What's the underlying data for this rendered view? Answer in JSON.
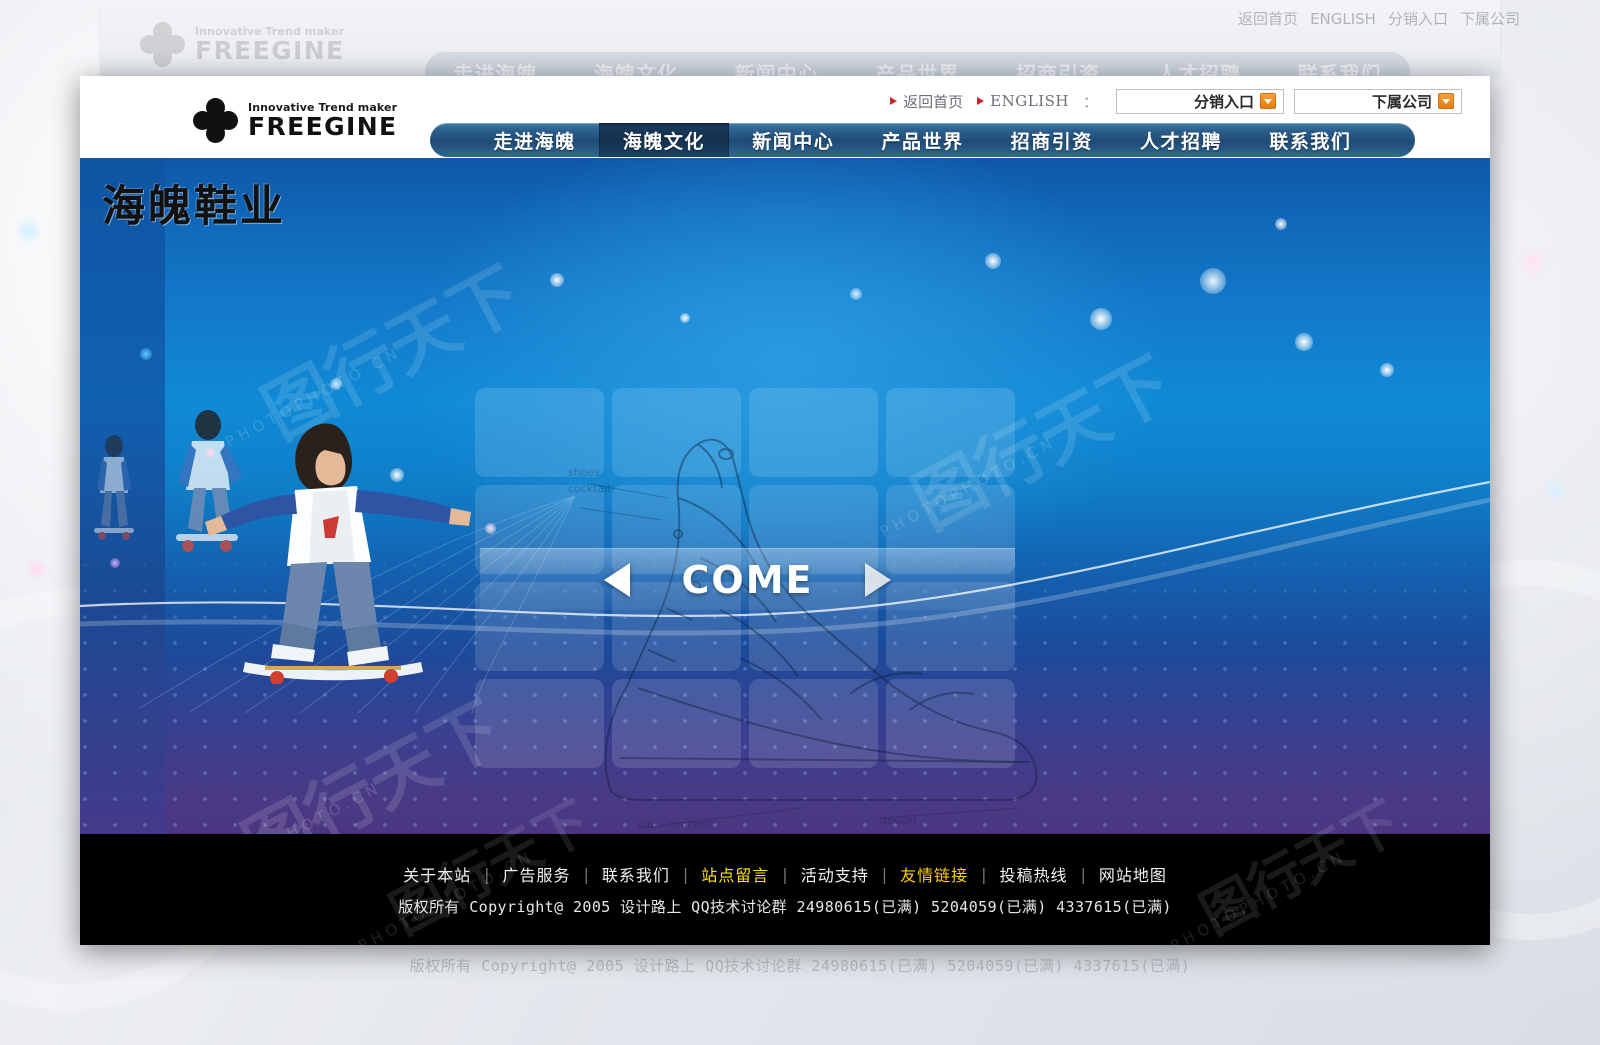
{
  "brand": {
    "tagline": "Innovative Trend maker",
    "name": "FREEGINE",
    "site_title": "海魄鞋业"
  },
  "topbar": {
    "home_link": "返回首页",
    "english_link": "ENGLISH",
    "colon": "：",
    "buttons": [
      {
        "label": "分销入口",
        "icon": "caret-down-icon"
      },
      {
        "label": "下属公司",
        "icon": "caret-down-icon"
      }
    ]
  },
  "nav": {
    "items": [
      {
        "label": "走进海魄",
        "active": false
      },
      {
        "label": "海魄文化",
        "active": true
      },
      {
        "label": "新闻中心",
        "active": false
      },
      {
        "label": "产品世界",
        "active": false
      },
      {
        "label": "招商引资",
        "active": false
      },
      {
        "label": "人才招聘",
        "active": false
      },
      {
        "label": "联系我们",
        "active": false
      }
    ]
  },
  "hero": {
    "title": "海魄鞋业",
    "cta_label": "COME",
    "prev_icon": "arrow-left-icon",
    "next_icon": "arrow-right-icon"
  },
  "footer": {
    "links": [
      {
        "label": "关于本站",
        "style": "normal"
      },
      {
        "label": "广告服务",
        "style": "normal"
      },
      {
        "label": "联系我们",
        "style": "normal"
      },
      {
        "label": "站点留言",
        "style": "yellow"
      },
      {
        "label": "活动支持",
        "style": "normal"
      },
      {
        "label": "友情链接",
        "style": "gold"
      },
      {
        "label": "投稿热线",
        "style": "normal"
      },
      {
        "label": "网站地图",
        "style": "normal"
      }
    ],
    "separator": "|",
    "copyright": "版权所有 Copyright@ 2005 设计路上 QQ技术讨论群 24980615(已满) 5204059(已满) 4337615(已满)"
  },
  "watermark": {
    "text": "图行天下",
    "sub": "PHOTOPHOTO.CN"
  },
  "colors": {
    "nav_bar": "#2c5f8d",
    "nav_active": "#14304d",
    "accent_orange": "#e87b12",
    "footer_bg": "#000000",
    "highlight_yellow": "#ffe400",
    "hero_blue": "#108ad6",
    "bullet_red": "#c2272d"
  }
}
